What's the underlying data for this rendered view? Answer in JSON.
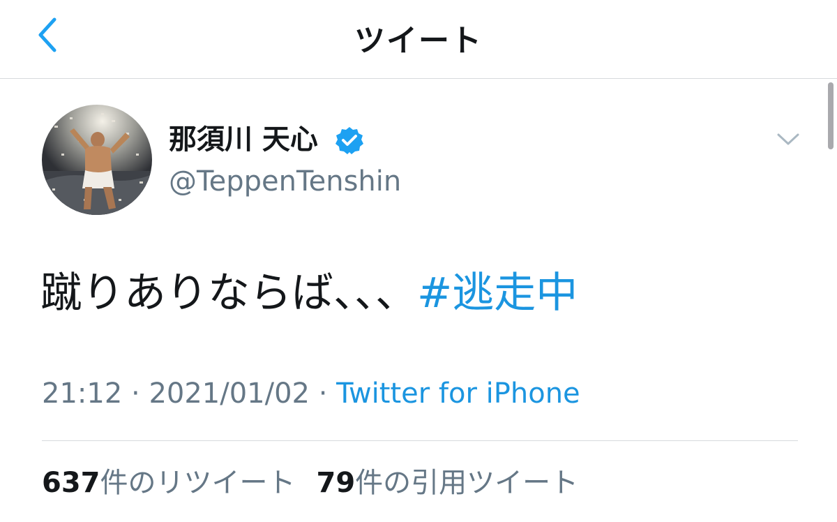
{
  "nav": {
    "title": "ツイート",
    "back_icon": "chevron-left-icon"
  },
  "tweet": {
    "display_name": "那須川 天心",
    "verified_icon": "verified-badge-icon",
    "handle": "@TeppenTenshin",
    "menu_icon": "chevron-down-icon",
    "text": "蹴りありならば、、、",
    "hashtag": "#逃走中",
    "time": "21:12",
    "separator": " · ",
    "date": "2021/01/02",
    "source": "Twitter for iPhone"
  },
  "stats": {
    "retweets_count": "637",
    "retweets_label": "件のリツイート",
    "quotes_count": "79",
    "quotes_label": "件の引用ツイート"
  },
  "colors": {
    "accent": "#1b95e0",
    "secondary_text": "#657786",
    "primary_text": "#14171a",
    "divider": "#d6d9dc"
  }
}
